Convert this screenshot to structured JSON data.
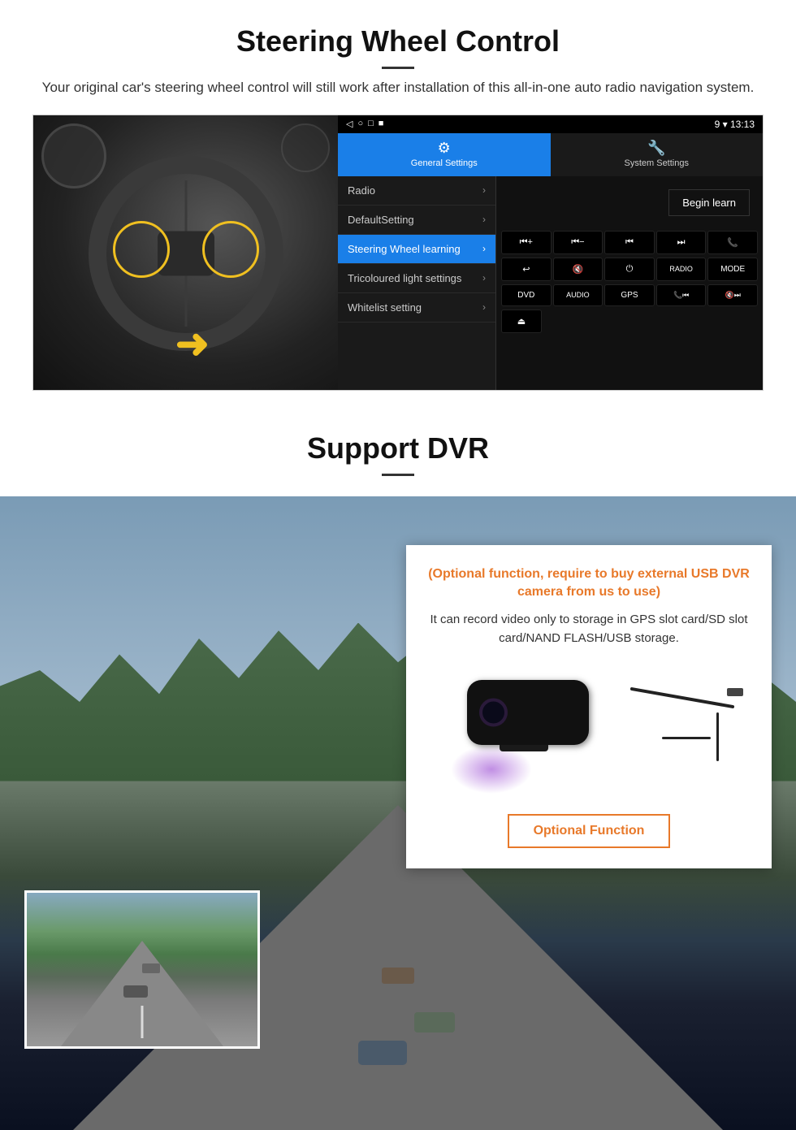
{
  "page": {
    "section1": {
      "title": "Steering Wheel Control",
      "description": "Your original car's steering wheel control will still work after installation of this all-in-one auto radio navigation system.",
      "panel": {
        "statusbar": {
          "back_icon": "◁",
          "home_icon": "○",
          "square_icon": "□",
          "menu_icon": "■",
          "signal": "▼",
          "wifi": "▾",
          "time": "13:13"
        },
        "tabs": [
          {
            "icon": "⚙",
            "label": "General Settings",
            "active": true
          },
          {
            "icon": "🔧",
            "label": "System Settings",
            "active": false
          }
        ],
        "menu_items": [
          {
            "label": "Radio",
            "active": false
          },
          {
            "label": "DefaultSetting",
            "active": false
          },
          {
            "label": "Steering Wheel learning",
            "active": true
          },
          {
            "label": "Tricoloured light settings",
            "active": false
          },
          {
            "label": "Whitelist setting",
            "active": false
          }
        ],
        "learn_button": "Begin learn",
        "control_buttons": [
          [
            "⏮+",
            "⏮−",
            "⏮⏮",
            "⏭⏭",
            "📞"
          ],
          [
            "↩",
            "🔇",
            "⏻",
            "RADIO",
            "MODE"
          ],
          [
            "DVD",
            "AUDIO",
            "GPS",
            "📞⏮⏮",
            "🔇⏭⏭"
          ],
          [
            "⏏"
          ]
        ]
      }
    },
    "section2": {
      "title": "Support DVR",
      "optional_text": "(Optional function, require to buy external USB DVR camera from us to use)",
      "description": "It can record video only to storage in GPS slot card/SD slot card/NAND FLASH/USB storage.",
      "optional_button": "Optional Function"
    }
  }
}
